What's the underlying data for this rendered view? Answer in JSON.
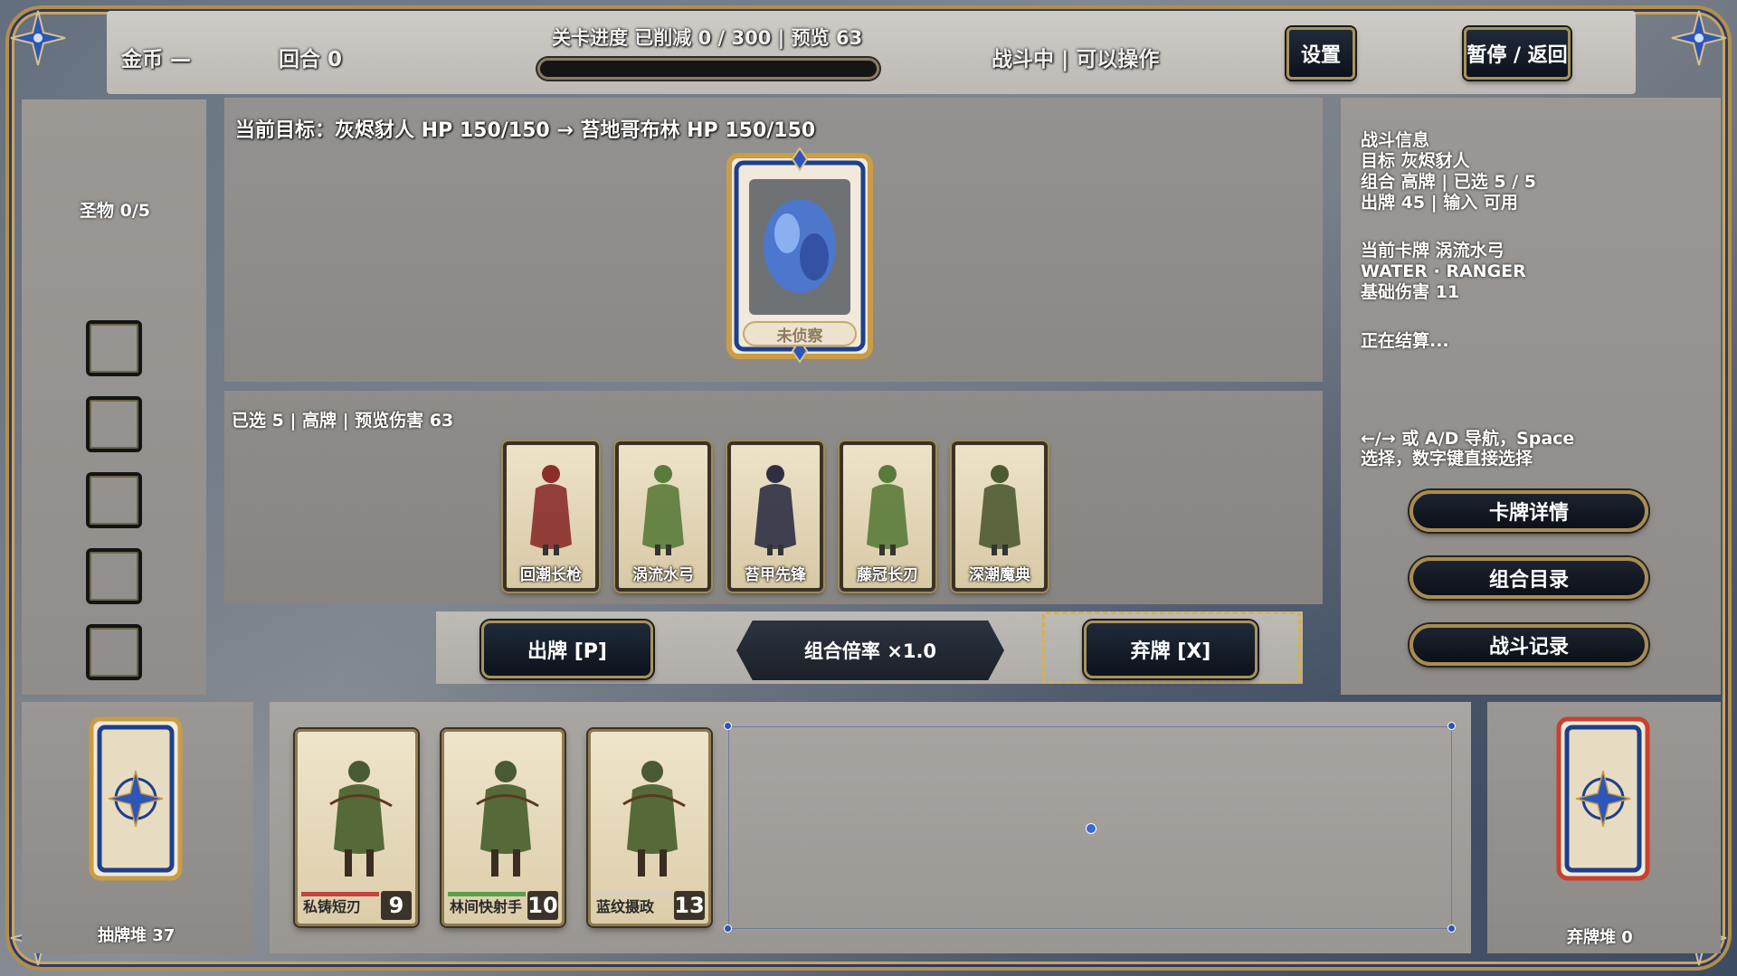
{
  "topbar": {
    "gold_label": "金币 —",
    "round_label": "回合 0",
    "progress_text": "关卡进度 已削减 0 / 300 | 预览 63",
    "progress_fraction": 0,
    "status_text": "战斗中 | 可以操作",
    "settings_label": "设置",
    "pause_label": "暂停 / 返回"
  },
  "relics": {
    "label": "圣物 0/5",
    "slots": 5
  },
  "target": {
    "title": "当前目标：灰烬豺人 HP 150/150 → 苔地哥布林 HP 150/150",
    "enemy_card_label": "未侦察"
  },
  "selection": {
    "info": "已选 5 | 高牌 | 预览伤害 63",
    "cards": [
      {
        "name": "回潮长枪",
        "figure": "red-hat-spearman-figure",
        "tint": "#8a2e2a"
      },
      {
        "name": "涡流水弓",
        "figure": "green-dryad-figure",
        "tint": "#5a7a3a"
      },
      {
        "name": "苔甲先锋",
        "figure": "dark-reaper-figure",
        "tint": "#2e2f44"
      },
      {
        "name": "藤冠长刃",
        "figure": "green-dryad-figure",
        "tint": "#5a7a3a"
      },
      {
        "name": "深潮魔典",
        "figure": "armored-warrior-figure",
        "tint": "#4c5a32"
      }
    ]
  },
  "actions": {
    "play_label": "出牌 [P]",
    "combo_label": "组合倍率 ×1.0",
    "discard_label": "弃牌 [X]"
  },
  "info_panel": {
    "lines_a": [
      "战斗信息",
      "目标 灰烬豺人",
      "组合 高牌 | 已选 5 / 5",
      "出牌 45 | 输入 可用"
    ],
    "lines_b": [
      "当前卡牌 涡流水弓",
      "WATER · RANGER",
      "基础伤害 11"
    ],
    "resolving": "正在结算...",
    "hint": [
      "←/→ 或 A/D 导航，Space",
      "选择，数字键直接选择"
    ],
    "btn_details": "卡牌详情",
    "btn_combos": "组合目录",
    "btn_log": "战斗记录"
  },
  "piles": {
    "draw_label": "抽牌堆 37",
    "discard_label": "弃牌堆 0"
  },
  "hand": [
    {
      "name": "私铸短刃",
      "cost": "9",
      "bar_color": "#c0453a"
    },
    {
      "name": "林间快射手",
      "cost": "10",
      "bar_color": "#5aa04a"
    },
    {
      "name": "蓝纹摄政",
      "cost": "13",
      "bar_color": "#d8d0bc"
    }
  ],
  "colors": {
    "gold": "#b48f4a",
    "navy": "#1a2f6a",
    "discard_red": "#c9402e"
  }
}
